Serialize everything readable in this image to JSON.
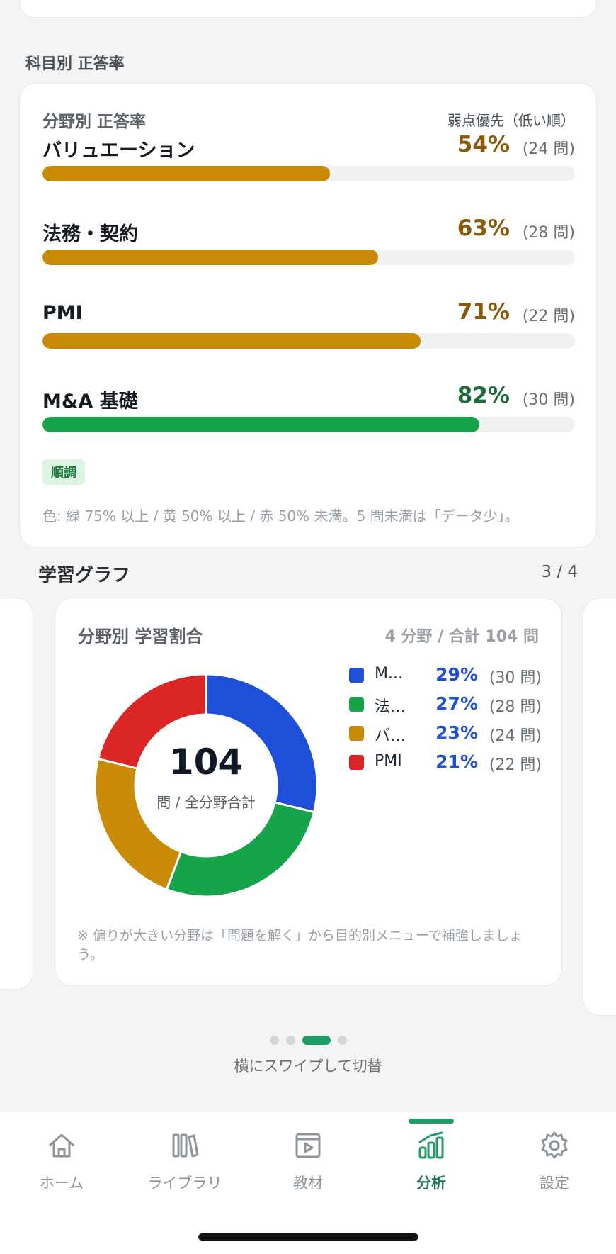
{
  "accuracy": {
    "section_title": "科目別 正答率",
    "card_title": "分野別 正答率",
    "sort_label": "弱点優先（低い順）",
    "subjects": [
      {
        "name": "バリュエーション",
        "percent_label": "54%",
        "count_label": "(24 問)",
        "rate": 54,
        "color": "#c98a06",
        "text_color": "#8a5a0a"
      },
      {
        "name": "法務・契約",
        "percent_label": "63%",
        "count_label": "(28 問)",
        "rate": 63,
        "color": "#c98a06",
        "text_color": "#8a5a0a"
      },
      {
        "name": "PMI",
        "percent_label": "71%",
        "count_label": "(22 問)",
        "rate": 71,
        "color": "#c98a06",
        "text_color": "#8a5a0a"
      },
      {
        "name": "M&A 基礎",
        "percent_label": "82%",
        "count_label": "(30 問)",
        "rate": 82,
        "color": "#17a34a",
        "text_color": "#1d6b38"
      }
    ],
    "status_badge": "順調",
    "color_legend": "色: 緑 75% 以上 / 黄 50% 以上 / 赤 50% 未満。5 問未満は「データ少」。"
  },
  "graph": {
    "section_title": "学習グラフ",
    "page_indicator": "3 / 4",
    "card_title": "分野別 学習割合",
    "summary": "4 分野 / 合計 104 問",
    "total": "104",
    "total_label": "問 / 全分野合計",
    "note": "※ 偏りが大きい分野は「問題を解く」から目的別メニューで補強しましょう。",
    "swipe_hint": "横にスワイプして切替"
  },
  "chart_data": {
    "type": "pie",
    "title": "分野別 学習割合",
    "categories": [
      "M&A 基礎",
      "法務・契約",
      "バリュエーション",
      "PMI"
    ],
    "legend_labels": [
      "M...",
      "法…",
      "バ…",
      "PMI"
    ],
    "values": [
      30,
      28,
      24,
      22
    ],
    "percent_labels": [
      "29%",
      "27%",
      "23%",
      "21%"
    ],
    "count_labels": [
      "(30 問)",
      "(28 問)",
      "(24 問)",
      "(22 問)"
    ],
    "colors": [
      "#1d4fd8",
      "#17a34a",
      "#c98a06",
      "#dc2626"
    ],
    "legend_placement": "right"
  },
  "tabbar": {
    "items": [
      {
        "label": "ホーム",
        "icon": "home-icon",
        "active": false
      },
      {
        "label": "ライブラリ",
        "icon": "library-icon",
        "active": false
      },
      {
        "label": "教材",
        "icon": "video-icon",
        "active": false
      },
      {
        "label": "分析",
        "icon": "chart-icon",
        "active": true
      },
      {
        "label": "設定",
        "icon": "gear-icon",
        "active": false
      }
    ]
  }
}
